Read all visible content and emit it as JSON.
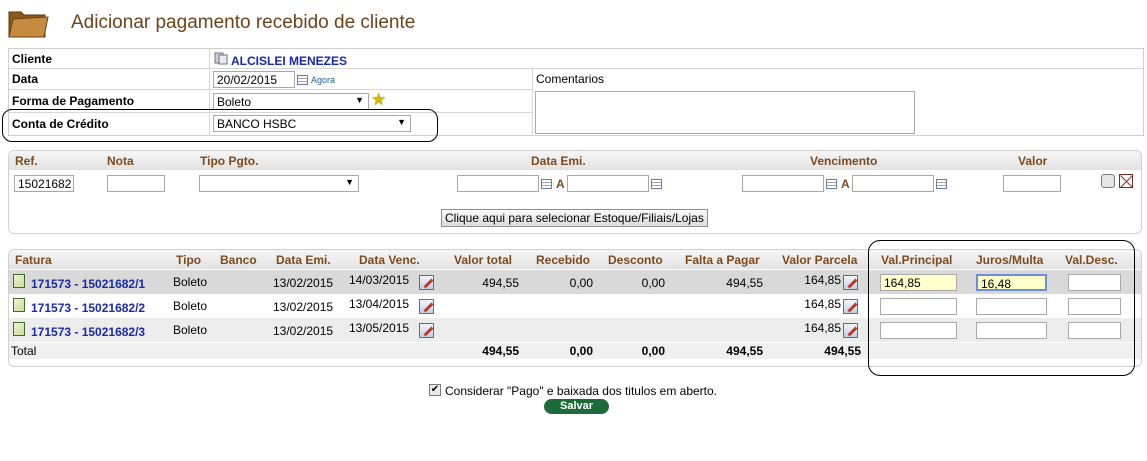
{
  "header": {
    "title": "Adicionar pagamento recebido de cliente",
    "icon": "folder-icon"
  },
  "form": {
    "cliente_label": "Cliente",
    "cliente_value": "ALCISLEI MENEZES",
    "data_label": "Data",
    "data_value": "20/02/2015",
    "agora_label": "Agora",
    "comentarios_label": "Comentarios",
    "comentarios_value": "",
    "forma_label": "Forma de Pagamento",
    "forma_value": "Boleto",
    "conta_label": "Conta de Crédito",
    "conta_value": "BANCO HSBC"
  },
  "filter": {
    "headers": {
      "ref": "Ref.",
      "nota": "Nota",
      "tipo": "Tipo Pgto.",
      "data_emi": "Data Emi.",
      "vencimento": "Vencimento",
      "valor": "Valor"
    },
    "ref_value": "15021682",
    "nota_value": "",
    "tipo_value": "",
    "data_emi_from": "",
    "data_emi_to": "",
    "venc_from": "",
    "venc_to": "",
    "valor_value": "",
    "range_sep": "A",
    "stock_button": "Clique aqui para selecionar Estoque/Filiais/Lojas"
  },
  "invoices": {
    "headers": {
      "fatura": "Fatura",
      "tipo": "Tipo",
      "banco": "Banco",
      "data_emi": "Data Emi.",
      "data_venc": "Data Venc.",
      "valor_total": "Valor total",
      "recebido": "Recebido",
      "desconto": "Desconto",
      "falta": "Falta a Pagar",
      "valor_parcela": "Valor Parcela",
      "val_principal": "Val.Principal",
      "juros": "Juros/Multa",
      "val_desc": "Val.Desc."
    },
    "rows": [
      {
        "fatura": "171573 - 15021682/1",
        "tipo": "Boleto",
        "banco": "",
        "data_emi": "13/02/2015",
        "data_venc": "14/03/2015",
        "valor_total": "494,55",
        "recebido": "0,00",
        "desconto": "0,00",
        "falta": "494,55",
        "valor_parcela": "164,85",
        "val_principal": "164,85",
        "juros": "16,48",
        "val_desc": ""
      },
      {
        "fatura": "171573 - 15021682/2",
        "tipo": "Boleto",
        "banco": "",
        "data_emi": "13/02/2015",
        "data_venc": "13/04/2015",
        "valor_total": "",
        "recebido": "",
        "desconto": "",
        "falta": "",
        "valor_parcela": "164,85",
        "val_principal": "",
        "juros": "",
        "val_desc": ""
      },
      {
        "fatura": "171573 - 15021682/3",
        "tipo": "Boleto",
        "banco": "",
        "data_emi": "13/02/2015",
        "data_venc": "13/05/2015",
        "valor_total": "",
        "recebido": "",
        "desconto": "",
        "falta": "",
        "valor_parcela": "164,85",
        "val_principal": "",
        "juros": "",
        "val_desc": ""
      }
    ],
    "total": {
      "label": "Total",
      "valor_total": "494,55",
      "recebido": "0,00",
      "desconto": "0,00",
      "falta": "494,55",
      "valor_parcela": "494,55"
    }
  },
  "footer": {
    "checkbox_checked": true,
    "checkbox_mark": "✔",
    "checkbox_label": "Considerar \"Pago\" e baixada dos titulos em aberto.",
    "save_label": "Salvar"
  },
  "colors": {
    "title": "#6d4319",
    "header_text": "#7b4a1e",
    "link": "#1a29a8",
    "save_button": "#1e6b3a",
    "highlight_input": "#ffffcc"
  }
}
